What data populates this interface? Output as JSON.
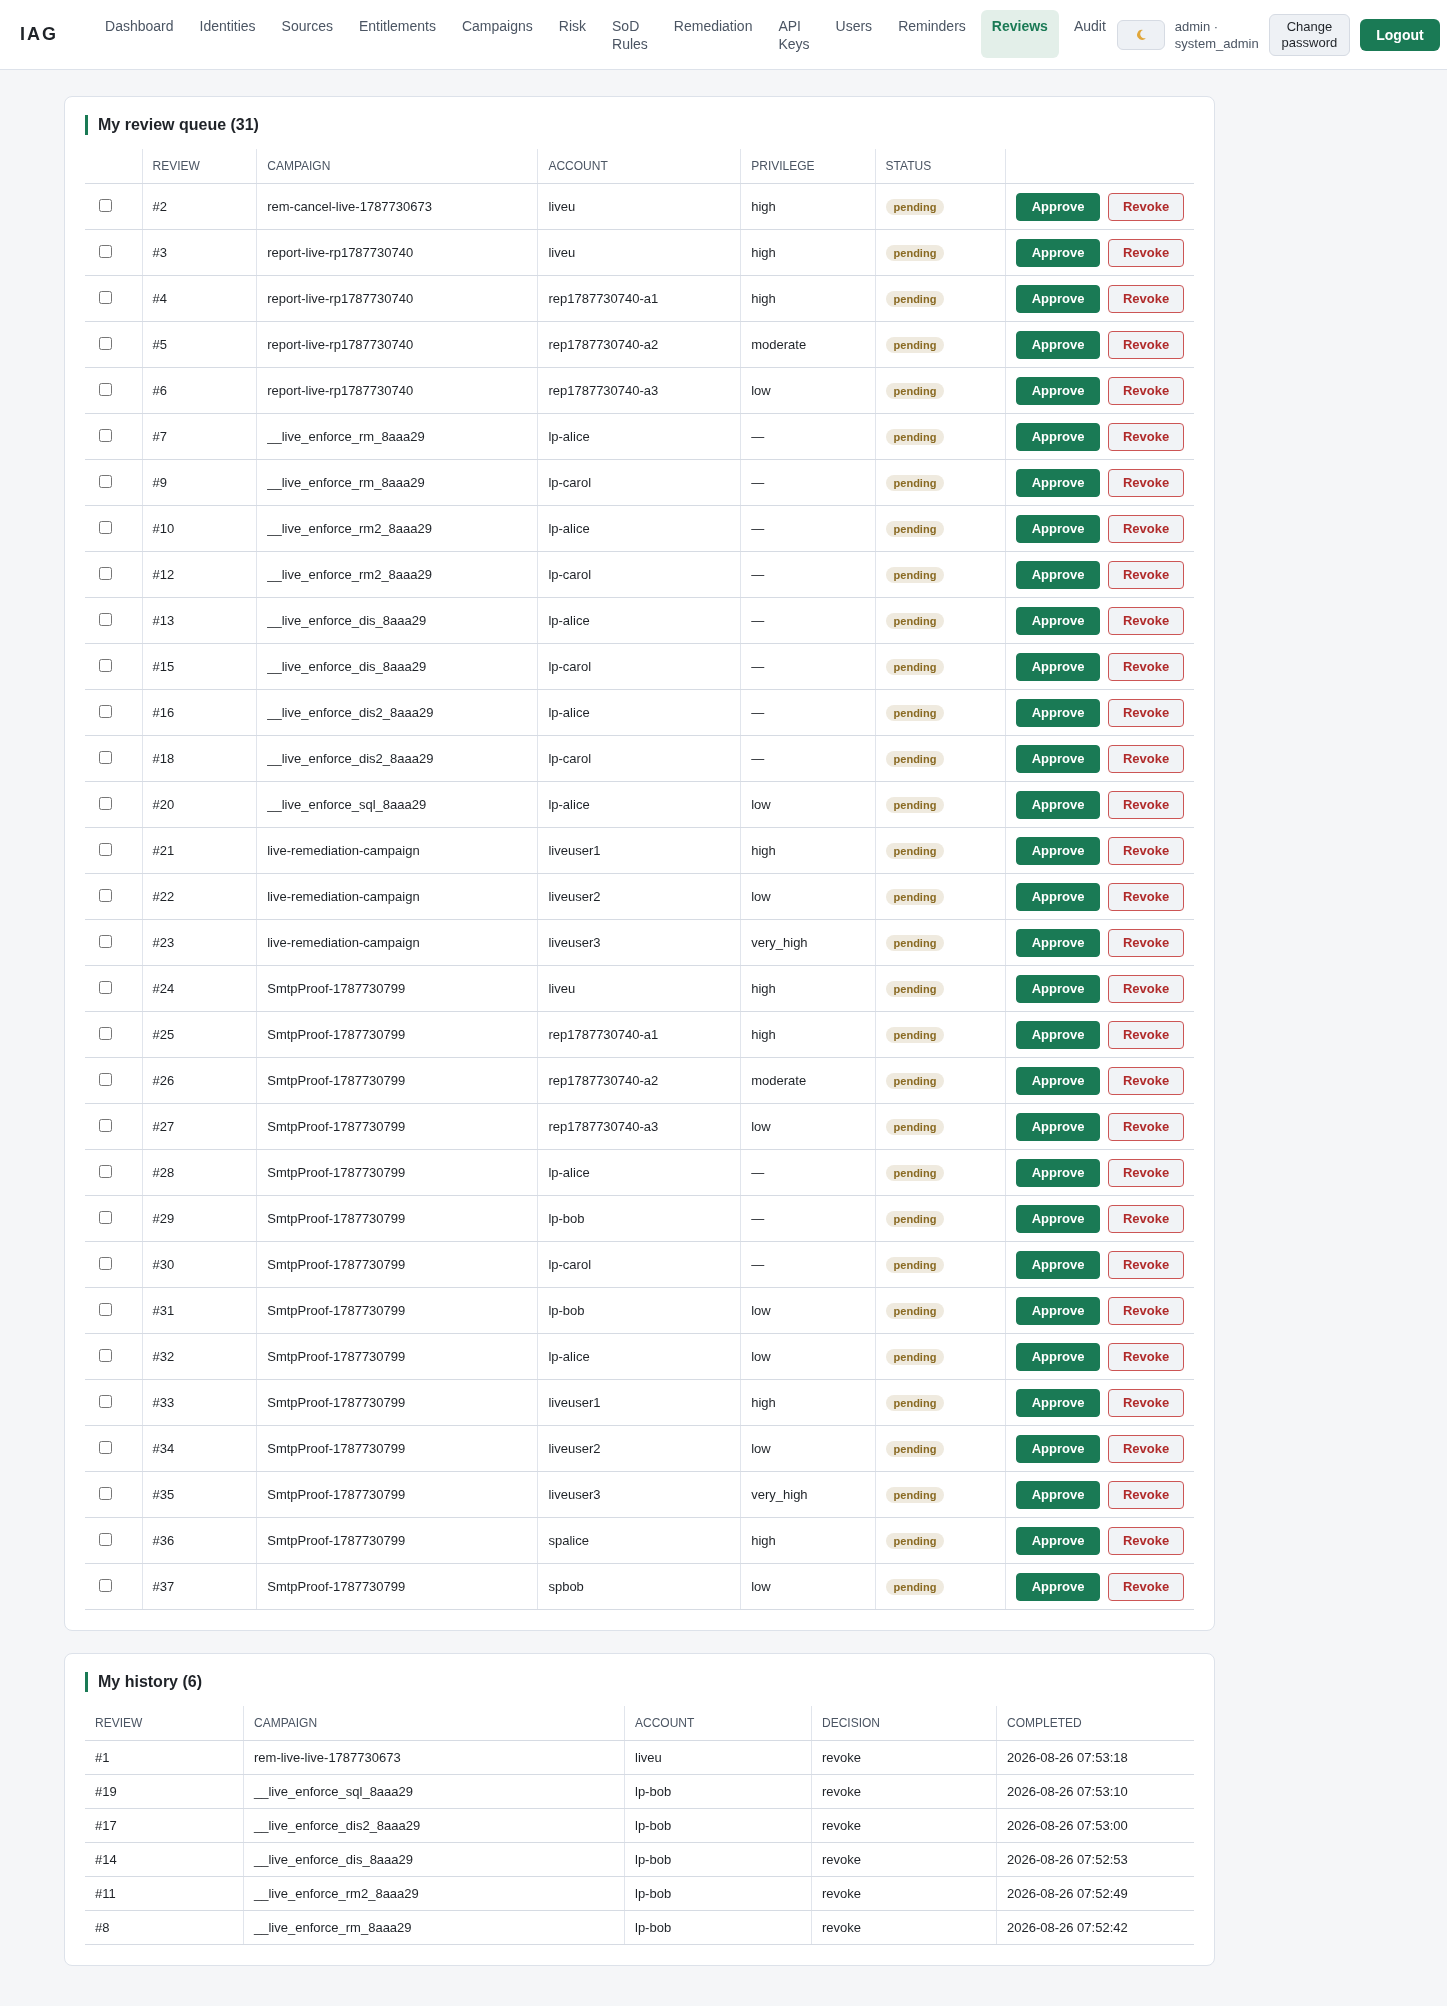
{
  "brand": "IAG",
  "nav": [
    {
      "lines": [
        "Dashboard"
      ],
      "selected": false
    },
    {
      "lines": [
        "Identities"
      ],
      "selected": false
    },
    {
      "lines": [
        "Sources"
      ],
      "selected": false
    },
    {
      "lines": [
        "Entitlements"
      ],
      "selected": false
    },
    {
      "lines": [
        "Campaigns"
      ],
      "selected": false
    },
    {
      "lines": [
        "Risk"
      ],
      "selected": false
    },
    {
      "lines": [
        "SoD",
        "Rules"
      ],
      "selected": false
    },
    {
      "lines": [
        "Remediation"
      ],
      "selected": false
    },
    {
      "lines": [
        "API",
        "Keys"
      ],
      "selected": false
    },
    {
      "lines": [
        "Users"
      ],
      "selected": false
    },
    {
      "lines": [
        "Reminders"
      ],
      "selected": false
    },
    {
      "lines": [
        "Reviews"
      ],
      "selected": true
    },
    {
      "lines": [
        "Audit"
      ],
      "selected": false
    }
  ],
  "user": {
    "lines": [
      "admin ·",
      "system_admin"
    ]
  },
  "header_buttons": {
    "change_password": [
      "Change",
      "password"
    ],
    "logout": "Logout"
  },
  "queue": {
    "title": "My review queue (31)",
    "columns": [
      "REVIEW",
      "CAMPAIGN",
      "ACCOUNT",
      "PRIVILEGE",
      "STATUS"
    ],
    "rows": [
      {
        "checked": false,
        "cells": [
          "#2",
          "rem-cancel-live-1787730673",
          "liveu",
          "high"
        ],
        "status": "pending",
        "actions": [
          "Approve",
          "Revoke"
        ]
      },
      {
        "checked": false,
        "cells": [
          "#3",
          "report-live-rp1787730740",
          "liveu",
          "high"
        ],
        "status": "pending",
        "actions": [
          "Approve",
          "Revoke"
        ]
      },
      {
        "checked": false,
        "cells": [
          "#4",
          "report-live-rp1787730740",
          "rep1787730740-a1",
          "high"
        ],
        "status": "pending",
        "actions": [
          "Approve",
          "Revoke"
        ]
      },
      {
        "checked": false,
        "cells": [
          "#5",
          "report-live-rp1787730740",
          "rep1787730740-a2",
          "moderate"
        ],
        "status": "pending",
        "actions": [
          "Approve",
          "Revoke"
        ]
      },
      {
        "checked": false,
        "cells": [
          "#6",
          "report-live-rp1787730740",
          "rep1787730740-a3",
          "low"
        ],
        "status": "pending",
        "actions": [
          "Approve",
          "Revoke"
        ]
      },
      {
        "checked": false,
        "cells": [
          "#7",
          "__live_enforce_rm_8aaa29",
          "lp-alice",
          "—"
        ],
        "status": "pending",
        "actions": [
          "Approve",
          "Revoke"
        ]
      },
      {
        "checked": false,
        "cells": [
          "#9",
          "__live_enforce_rm_8aaa29",
          "lp-carol",
          "—"
        ],
        "status": "pending",
        "actions": [
          "Approve",
          "Revoke"
        ]
      },
      {
        "checked": false,
        "cells": [
          "#10",
          "__live_enforce_rm2_8aaa29",
          "lp-alice",
          "—"
        ],
        "status": "pending",
        "actions": [
          "Approve",
          "Revoke"
        ]
      },
      {
        "checked": false,
        "cells": [
          "#12",
          "__live_enforce_rm2_8aaa29",
          "lp-carol",
          "—"
        ],
        "status": "pending",
        "actions": [
          "Approve",
          "Revoke"
        ]
      },
      {
        "checked": false,
        "cells": [
          "#13",
          "__live_enforce_dis_8aaa29",
          "lp-alice",
          "—"
        ],
        "status": "pending",
        "actions": [
          "Approve",
          "Revoke"
        ]
      },
      {
        "checked": false,
        "cells": [
          "#15",
          "__live_enforce_dis_8aaa29",
          "lp-carol",
          "—"
        ],
        "status": "pending",
        "actions": [
          "Approve",
          "Revoke"
        ]
      },
      {
        "checked": false,
        "cells": [
          "#16",
          "__live_enforce_dis2_8aaa29",
          "lp-alice",
          "—"
        ],
        "status": "pending",
        "actions": [
          "Approve",
          "Revoke"
        ]
      },
      {
        "checked": false,
        "cells": [
          "#18",
          "__live_enforce_dis2_8aaa29",
          "lp-carol",
          "—"
        ],
        "status": "pending",
        "actions": [
          "Approve",
          "Revoke"
        ]
      },
      {
        "checked": false,
        "cells": [
          "#20",
          "__live_enforce_sql_8aaa29",
          "lp-alice",
          "low"
        ],
        "status": "pending",
        "actions": [
          "Approve",
          "Revoke"
        ]
      },
      {
        "checked": false,
        "cells": [
          "#21",
          "live-remediation-campaign",
          "liveuser1",
          "high"
        ],
        "status": "pending",
        "actions": [
          "Approve",
          "Revoke"
        ]
      },
      {
        "checked": false,
        "cells": [
          "#22",
          "live-remediation-campaign",
          "liveuser2",
          "low"
        ],
        "status": "pending",
        "actions": [
          "Approve",
          "Revoke"
        ]
      },
      {
        "checked": false,
        "cells": [
          "#23",
          "live-remediation-campaign",
          "liveuser3",
          "very_high"
        ],
        "status": "pending",
        "actions": [
          "Approve",
          "Revoke"
        ]
      },
      {
        "checked": false,
        "cells": [
          "#24",
          "SmtpProof-1787730799",
          "liveu",
          "high"
        ],
        "status": "pending",
        "actions": [
          "Approve",
          "Revoke"
        ]
      },
      {
        "checked": false,
        "cells": [
          "#25",
          "SmtpProof-1787730799",
          "rep1787730740-a1",
          "high"
        ],
        "status": "pending",
        "actions": [
          "Approve",
          "Revoke"
        ]
      },
      {
        "checked": false,
        "cells": [
          "#26",
          "SmtpProof-1787730799",
          "rep1787730740-a2",
          "moderate"
        ],
        "status": "pending",
        "actions": [
          "Approve",
          "Revoke"
        ]
      },
      {
        "checked": false,
        "cells": [
          "#27",
          "SmtpProof-1787730799",
          "rep1787730740-a3",
          "low"
        ],
        "status": "pending",
        "actions": [
          "Approve",
          "Revoke"
        ]
      },
      {
        "checked": false,
        "cells": [
          "#28",
          "SmtpProof-1787730799",
          "lp-alice",
          "—"
        ],
        "status": "pending",
        "actions": [
          "Approve",
          "Revoke"
        ]
      },
      {
        "checked": false,
        "cells": [
          "#29",
          "SmtpProof-1787730799",
          "lp-bob",
          "—"
        ],
        "status": "pending",
        "actions": [
          "Approve",
          "Revoke"
        ]
      },
      {
        "checked": false,
        "cells": [
          "#30",
          "SmtpProof-1787730799",
          "lp-carol",
          "—"
        ],
        "status": "pending",
        "actions": [
          "Approve",
          "Revoke"
        ]
      },
      {
        "checked": false,
        "cells": [
          "#31",
          "SmtpProof-1787730799",
          "lp-bob",
          "low"
        ],
        "status": "pending",
        "actions": [
          "Approve",
          "Revoke"
        ]
      },
      {
        "checked": false,
        "cells": [
          "#32",
          "SmtpProof-1787730799",
          "lp-alice",
          "low"
        ],
        "status": "pending",
        "actions": [
          "Approve",
          "Revoke"
        ]
      },
      {
        "checked": false,
        "cells": [
          "#33",
          "SmtpProof-1787730799",
          "liveuser1",
          "high"
        ],
        "status": "pending",
        "actions": [
          "Approve",
          "Revoke"
        ]
      },
      {
        "checked": false,
        "cells": [
          "#34",
          "SmtpProof-1787730799",
          "liveuser2",
          "low"
        ],
        "status": "pending",
        "actions": [
          "Approve",
          "Revoke"
        ]
      },
      {
        "checked": false,
        "cells": [
          "#35",
          "SmtpProof-1787730799",
          "liveuser3",
          "very_high"
        ],
        "status": "pending",
        "actions": [
          "Approve",
          "Revoke"
        ]
      },
      {
        "checked": false,
        "cells": [
          "#36",
          "SmtpProof-1787730799",
          "spalice",
          "high"
        ],
        "status": "pending",
        "actions": [
          "Approve",
          "Revoke"
        ]
      },
      {
        "checked": false,
        "cells": [
          "#37",
          "SmtpProof-1787730799",
          "spbob",
          "low"
        ],
        "status": "pending",
        "actions": [
          "Approve",
          "Revoke"
        ]
      }
    ]
  },
  "history": {
    "title": "My history (6)",
    "columns": [
      "REVIEW",
      "CAMPAIGN",
      "ACCOUNT",
      "DECISION",
      "COMPLETED"
    ],
    "rows": [
      [
        "#1",
        "rem-live-live-1787730673",
        "liveu",
        "revoke",
        "2026-08-26 07:53:18"
      ],
      [
        "#19",
        "__live_enforce_sql_8aaa29",
        "lp-bob",
        "revoke",
        "2026-08-26 07:53:10"
      ],
      [
        "#17",
        "__live_enforce_dis2_8aaa29",
        "lp-bob",
        "revoke",
        "2026-08-26 07:53:00"
      ],
      [
        "#14",
        "__live_enforce_dis_8aaa29",
        "lp-bob",
        "revoke",
        "2026-08-26 07:52:53"
      ],
      [
        "#11",
        "__live_enforce_rm2_8aaa29",
        "lp-bob",
        "revoke",
        "2026-08-26 07:52:49"
      ],
      [
        "#8",
        "__live_enforce_rm_8aaa29",
        "lp-bob",
        "revoke",
        "2026-08-26 07:52:42"
      ]
    ]
  }
}
